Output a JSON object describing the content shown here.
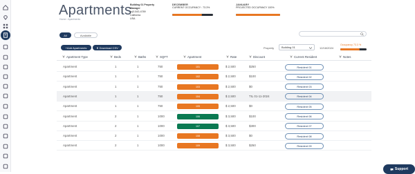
{
  "colors": {
    "brand": "#1f3a5f",
    "orange": "#e87722",
    "green": "#0a7a52",
    "dark_bar": "#2a2f36"
  },
  "sidebar": {
    "icons": [
      "home-icon",
      "location-icon",
      "grid-icon",
      "building-icon",
      "calendar-icon",
      "file-icon",
      "list-icon",
      "bank-icon",
      "cart-icon",
      "person-icon",
      "people-icon",
      "mail-icon",
      "document-icon",
      "chat-icon",
      "tag-icon",
      "gear-icon",
      "columns-icon",
      "link-icon",
      "help-icon",
      "expand-icon"
    ]
  },
  "header": {
    "title": "Apartments",
    "breadcrumb": "Home › Apartments",
    "property": {
      "line1": "Building 01 Property",
      "line2": "Manager",
      "phone": "(x)0-543-4789",
      "state": "California",
      "country": "USA"
    },
    "current": {
      "month": "DECEMBER",
      "label": "CURRENT OCCUPANCY : 73.3%",
      "fraction": 0.733
    },
    "projected": {
      "month": "JANUARY",
      "label": "PROJECTED OCCUPANCY 100%",
      "fraction": 1.0
    }
  },
  "filters": {
    "all": "All",
    "available": "Available"
  },
  "toolbar": {
    "add": "+Add Apartments",
    "download": "⬇ Download CSV",
    "property_label": "Property",
    "property_value": "Building 01",
    "date": "12/18/2024",
    "occupancy": "Occupancy 73.3 %",
    "occupancy_fraction": 0.733
  },
  "table": {
    "columns": [
      "Apartment Type",
      "Beds",
      "Baths",
      "SQFT",
      "Apartment",
      "Rate",
      "Discount",
      "Current Resident",
      "Notes"
    ],
    "rows": [
      {
        "type": "Apartment",
        "beds": "1",
        "baths": "1",
        "sqft": "750",
        "apt": "101",
        "color": "orange",
        "rate": "$ 2,500",
        "discount": "$250",
        "resident": "Resident 01"
      },
      {
        "type": "Apartment",
        "beds": "1",
        "baths": "1",
        "sqft": "750",
        "apt": "102",
        "color": "orange",
        "rate": "$ 2,500",
        "discount": "$100",
        "resident": "Resident 02"
      },
      {
        "type": "Apartment",
        "beds": "1",
        "baths": "1",
        "sqft": "750",
        "apt": "103",
        "color": "orange",
        "rate": "$ 2,500",
        "discount": "$0",
        "resident": "Resident 03"
      },
      {
        "type": "Apartment",
        "beds": "1",
        "baths": "1",
        "sqft": "750",
        "apt": "104",
        "color": "orange",
        "rate": "$ 2,500",
        "discount": "TIL 01-11-2024",
        "resident": "Resident 04"
      },
      {
        "type": "Apartment",
        "beds": "1",
        "baths": "1",
        "sqft": "750",
        "apt": "105",
        "color": "orange",
        "rate": "$ 2,500",
        "discount": "$0",
        "resident": "Resident 05"
      },
      {
        "type": "Apartment",
        "beds": "2",
        "baths": "1",
        "sqft": "1000",
        "apt": "106",
        "color": "green",
        "rate": "$ 3,500",
        "discount": "$100",
        "resident": "Resident 06"
      },
      {
        "type": "Apartment",
        "beds": "2",
        "baths": "1",
        "sqft": "1000",
        "apt": "107",
        "color": "green",
        "rate": "$ 3,500",
        "discount": "$300",
        "resident": "Resident 07"
      },
      {
        "type": "Apartment",
        "beds": "2",
        "baths": "1",
        "sqft": "1000",
        "apt": "108",
        "color": "orange",
        "rate": "$ 3,500",
        "discount": "$0",
        "resident": "Resident 08"
      },
      {
        "type": "Apartment",
        "beds": "2",
        "baths": "1",
        "sqft": "1000",
        "apt": "109",
        "color": "orange",
        "rate": "$ 3,500",
        "discount": "$250",
        "resident": "Resident 09"
      }
    ]
  },
  "support": "Support"
}
